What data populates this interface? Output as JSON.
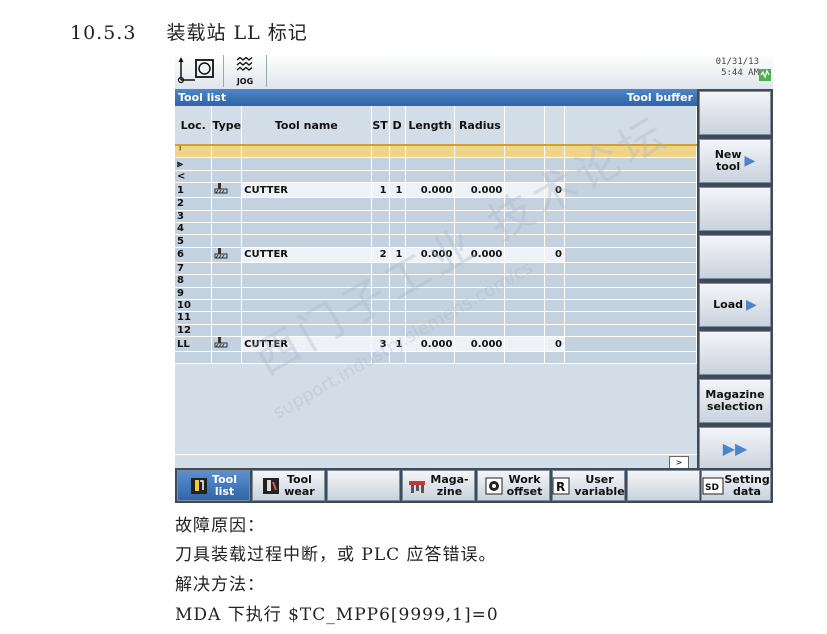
{
  "doc": {
    "section_number": "10.5.3",
    "section_title": "装载站 LL 标记",
    "cause_heading": "故障原因：",
    "cause_text": "刀具装载过程中断，或 PLC 应答错误。",
    "solution_heading": "解决方法：",
    "solution_text": "MDA 下执行 $TC_MPP6[9999,1]=0"
  },
  "status": {
    "mode": "JOG",
    "date": "01/31/13",
    "time": "5:44 AM"
  },
  "title": {
    "left": "Tool list",
    "right": "Tool buffer"
  },
  "table": {
    "headers": [
      "Loc.",
      "Type",
      "Tool name",
      "ST",
      "D",
      "Length",
      "Radius",
      "",
      ""
    ],
    "rows": [
      {
        "loc": "╵",
        "icon": "spindle-icon",
        "type": "",
        "name": "",
        "st": "",
        "d": "",
        "length": "",
        "radius": "",
        "c9": "",
        "selected": true
      },
      {
        "loc": "⪢",
        "icon": "gripper-1-icon",
        "type": "",
        "name": "",
        "st": "",
        "d": "",
        "length": "",
        "radius": "",
        "c9": ""
      },
      {
        "loc": "<",
        "icon": "gripper-2-icon",
        "type": "",
        "name": "",
        "st": "",
        "d": "",
        "length": "",
        "radius": "",
        "c9": ""
      },
      {
        "loc": "1",
        "type": "mill",
        "name": "CUTTER",
        "st": "1",
        "d": "1",
        "length": "0.000",
        "radius": "0.000",
        "c9": "0"
      },
      {
        "loc": "2",
        "type": "",
        "name": "",
        "st": "",
        "d": "",
        "length": "",
        "radius": "",
        "c9": ""
      },
      {
        "loc": "3",
        "type": "",
        "name": "",
        "st": "",
        "d": "",
        "length": "",
        "radius": "",
        "c9": ""
      },
      {
        "loc": "4",
        "type": "",
        "name": "",
        "st": "",
        "d": "",
        "length": "",
        "radius": "",
        "c9": ""
      },
      {
        "loc": "5",
        "type": "",
        "name": "",
        "st": "",
        "d": "",
        "length": "",
        "radius": "",
        "c9": ""
      },
      {
        "loc": "6",
        "type": "mill",
        "name": "CUTTER",
        "st": "2",
        "d": "1",
        "length": "0.000",
        "radius": "0.000",
        "c9": "0"
      },
      {
        "loc": "7",
        "type": "",
        "name": "",
        "st": "",
        "d": "",
        "length": "",
        "radius": "",
        "c9": ""
      },
      {
        "loc": "8",
        "type": "",
        "name": "",
        "st": "",
        "d": "",
        "length": "",
        "radius": "",
        "c9": ""
      },
      {
        "loc": "9",
        "type": "",
        "name": "",
        "st": "",
        "d": "",
        "length": "",
        "radius": "",
        "c9": ""
      },
      {
        "loc": "10",
        "type": "",
        "name": "",
        "st": "",
        "d": "",
        "length": "",
        "radius": "",
        "c9": ""
      },
      {
        "loc": "11",
        "type": "",
        "name": "",
        "st": "",
        "d": "",
        "length": "",
        "radius": "",
        "c9": ""
      },
      {
        "loc": "12",
        "type": "",
        "name": "",
        "st": "",
        "d": "",
        "length": "",
        "radius": "",
        "c9": ""
      },
      {
        "loc": "LL",
        "type": "mill",
        "name": "CUTTER",
        "st": "3",
        "d": "1",
        "length": "0.000",
        "radius": "0.000",
        "c9": "0"
      },
      {
        "loc": "",
        "type": "",
        "name": "",
        "st": "",
        "d": "",
        "length": "",
        "radius": "",
        "c9": ""
      }
    ]
  },
  "softkeys_vertical": [
    {
      "label": "",
      "arrow": false
    },
    {
      "label": "New\ntool",
      "arrow": true
    },
    {
      "label": "",
      "arrow": false
    },
    {
      "label": "",
      "arrow": false
    },
    {
      "label": "Load",
      "arrow": true
    },
    {
      "label": "",
      "arrow": false
    },
    {
      "label": "Magazine\nselection",
      "arrow": false
    },
    {
      "label": "▶▶",
      "arrow": false
    }
  ],
  "softkeys_horizontal": [
    {
      "label": "Tool\nlist",
      "icon": "tool-list-icon",
      "active": true
    },
    {
      "label": "Tool\nwear",
      "icon": "tool-wear-icon",
      "active": false
    },
    {
      "label": "",
      "icon": "",
      "active": false
    },
    {
      "label": "Maga-\nzine",
      "icon": "magazine-icon",
      "active": false
    },
    {
      "label": "Work\noffset",
      "icon": "work-offset-icon",
      "active": false
    },
    {
      "label": "User\nvariable",
      "icon": "user-variable-icon",
      "active": false
    },
    {
      "label": "",
      "icon": "",
      "active": false
    },
    {
      "label": "Setting\ndata",
      "icon": "setting-data-icon",
      "active": false
    }
  ],
  "watermark": {
    "line1": "西门子工业 技术论坛",
    "line2": "support.industry.siemens.com/cs"
  },
  "scroll_right": ">"
}
